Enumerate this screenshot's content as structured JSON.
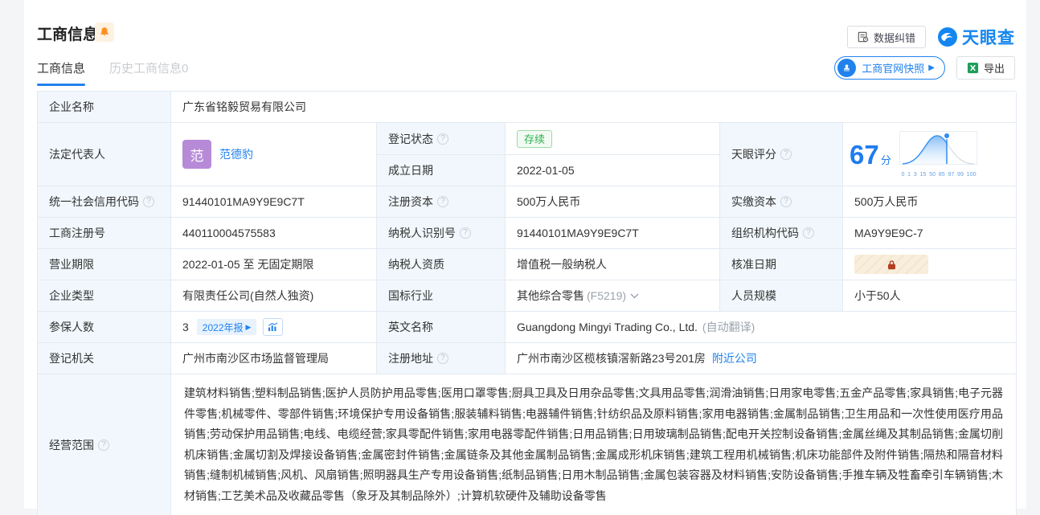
{
  "header": {
    "title": "工商信息",
    "data_correction": "数据纠错",
    "logo_text": "天眼查",
    "snapshot_button": "工商官网快照",
    "export_button": "导出"
  },
  "tabs": [
    {
      "label": "工商信息",
      "active": true
    },
    {
      "label": "历史工商信息0",
      "active": false
    }
  ],
  "score": {
    "label": "天眼评分",
    "value": "67",
    "unit": "分",
    "axis_ticks": [
      "0",
      "1",
      "3",
      "15",
      "50",
      "85",
      "97",
      "99",
      "100"
    ]
  },
  "fields": {
    "company_name": {
      "label": "企业名称",
      "value": "广东省铭毅贸易有限公司"
    },
    "legal_rep": {
      "label": "法定代表人",
      "avatar_char": "范",
      "name": "范德豹"
    },
    "reg_status": {
      "label": "登记状态",
      "value": "存续"
    },
    "establish_date": {
      "label": "成立日期",
      "value": "2022-01-05"
    },
    "credit_code": {
      "label": "统一社会信用代码",
      "value": "91440101MA9Y9E9C7T"
    },
    "reg_capital": {
      "label": "注册资本",
      "value": "500万人民币"
    },
    "paid_capital": {
      "label": "实缴资本",
      "value": "500万人民币"
    },
    "reg_number": {
      "label": "工商注册号",
      "value": "440110004575583"
    },
    "taxpayer_id": {
      "label": "纳税人识别号",
      "value": "91440101MA9Y9E9C7T"
    },
    "org_code": {
      "label": "组织机构代码",
      "value": "MA9Y9E9C-7"
    },
    "business_term": {
      "label": "营业期限",
      "value": "2022-01-05 至 无固定期限"
    },
    "taxpayer_quality": {
      "label": "纳税人资质",
      "value": "增值税一般纳税人"
    },
    "approval_date": {
      "label": "核准日期"
    },
    "company_type": {
      "label": "企业类型",
      "value": "有限责任公司(自然人独资)"
    },
    "industry": {
      "label": "国标行业",
      "value": "其他综合零售",
      "code": "(F5219)"
    },
    "staff_size": {
      "label": "人员规模",
      "value": "小于50人"
    },
    "insured_count": {
      "label": "参保人数",
      "value": "3",
      "badge": "2022年报"
    },
    "english_name": {
      "label": "英文名称",
      "value": "Guangdong Mingyi Trading Co., Ltd.",
      "note": "(自动翻译)"
    },
    "reg_authority": {
      "label": "登记机关",
      "value": "广州市南沙区市场监督管理局"
    },
    "reg_address": {
      "label": "注册地址",
      "value": "广州市南沙区榄核镇滘新路23号201房",
      "link": "附近公司"
    },
    "business_scope": {
      "label": "经营范围",
      "value": "建筑材料销售;塑料制品销售;医护人员防护用品零售;医用口罩零售;厨具卫具及日用杂品零售;文具用品零售;润滑油销售;日用家电零售;五金产品零售;家具销售;电子元器件零售;机械零件、零部件销售;环境保护专用设备销售;服装辅料销售;电器辅件销售;针纺织品及原料销售;家用电器销售;金属制品销售;卫生用品和一次性使用医疗用品销售;劳动保护用品销售;电线、电缆经营;家具零配件销售;家用电器零配件销售;日用品销售;日用玻璃制品销售;配电开关控制设备销售;金属丝绳及其制品销售;金属切削机床销售;金属切割及焊接设备销售;金属密封件销售;金属链条及其他金属制品销售;金属成形机床销售;建筑工程用机械销售;机床功能部件及附件销售;隔热和隔音材料销售;缝制机械销售;风机、风扇销售;照明器具生产专用设备销售;纸制品销售;日用木制品销售;金属包装容器及材料销售;安防设备销售;手推车辆及牲畜牵引车辆销售;木材销售;工艺美术品及收藏品零售（象牙及其制品除外）;计算机软硬件及辅助设备零售"
    }
  },
  "colors": {
    "accent_blue": "#2082ed",
    "status_green": "#2eb14e",
    "avatar_purple": "#b78ad8",
    "bell_orange": "#ff8f1f",
    "lock_red": "#b23d20"
  }
}
